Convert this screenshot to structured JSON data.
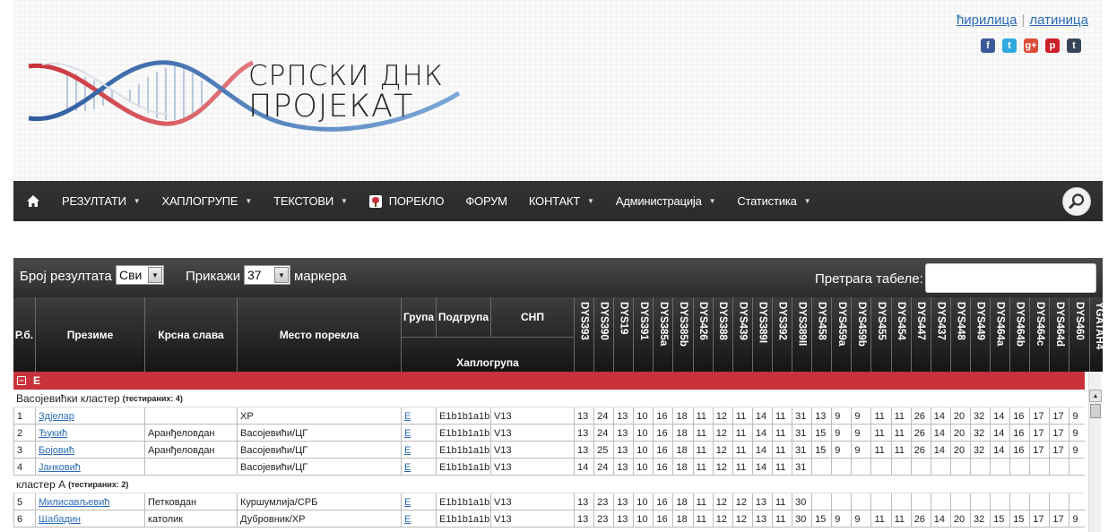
{
  "header": {
    "logo_line1": "СРПСКИ ДНК",
    "logo_line2": "ПРОЈЕКАТ",
    "lang_cyr": "ћирилица",
    "lang_sep": "|",
    "lang_lat": "латиница",
    "social": [
      {
        "name": "facebook-icon",
        "glyph": "f",
        "color": "#3b5998"
      },
      {
        "name": "twitter-icon",
        "glyph": "t",
        "color": "#2fa9e0"
      },
      {
        "name": "google-plus-icon",
        "glyph": "g+",
        "color": "#dd4b39"
      },
      {
        "name": "pinterest-icon",
        "glyph": "p",
        "color": "#cb2027"
      },
      {
        "name": "tumblr-icon",
        "glyph": "t",
        "color": "#35465c"
      }
    ]
  },
  "nav": {
    "items": [
      {
        "label": "РЕЗУЛТАТИ",
        "caret": true
      },
      {
        "label": "ХАПЛОГРУПЕ",
        "caret": true
      },
      {
        "label": "ТЕКСТОВИ",
        "caret": true
      },
      {
        "label": "ПОРЕКЛО",
        "caret": false,
        "icon": true
      },
      {
        "label": "ФОРУМ",
        "caret": false
      },
      {
        "label": "КОНТАКТ",
        "caret": true
      },
      {
        "label": "Администрација",
        "caret": true
      },
      {
        "label": "Статистика",
        "caret": true
      }
    ]
  },
  "toolbar": {
    "results_label": "Број резултата",
    "results_value": "Сви",
    "show_label": "Прикажи",
    "show_value": "37",
    "markers_label": "маркера",
    "search_label": "Претрага табеле:"
  },
  "table": {
    "headers": {
      "rb": "Р.б.",
      "surname": "Презиме",
      "slava": "Крсна слава",
      "place": "Место порекла",
      "group": "Група",
      "subgroup": "Подгрупа",
      "snp": "СНП",
      "haplogroup": "Хаплогрупа"
    },
    "markers": [
      "DYS393",
      "DYS390",
      "DYS19",
      "DYS391",
      "DYS385a",
      "DYS385b",
      "DYS426",
      "DYS388",
      "DYS439",
      "DYS389I",
      "DYS392",
      "DYS389II",
      "DYS458",
      "DYS459a",
      "DYS459b",
      "DYS455",
      "DYS454",
      "DYS447",
      "DYS437",
      "DYS448",
      "DYS449",
      "DYS464a",
      "DYS464b",
      "DYS464c",
      "DYS464d",
      "DYS460",
      "YGATAH4"
    ],
    "group_label": "E",
    "clusters": [
      {
        "title": "Васојевићки кластер",
        "note": "(тестираних: 4)",
        "rows": [
          {
            "n": "1",
            "surname": "Здјелар",
            "slava": "",
            "place": "ХР",
            "group": "E",
            "subgroup": "E1b1b1a1b",
            "snp": "V13",
            "values": [
              "13",
              "24",
              "13",
              "10",
              "16",
              "18",
              "11",
              "12",
              "11",
              "14",
              "11",
              "31",
              "13",
              "9",
              "9",
              "11",
              "11",
              "26",
              "14",
              "20",
              "32",
              "14",
              "16",
              "17",
              "17",
              "9",
              ""
            ]
          },
          {
            "n": "2",
            "surname": "Ђукић",
            "slava": "Аранђеловдан",
            "place": "Васојевићи/ЦГ",
            "group": "E",
            "subgroup": "E1b1b1a1b",
            "snp": "V13",
            "values": [
              "13",
              "24",
              "13",
              "10",
              "16",
              "18",
              "11",
              "12",
              "11",
              "14",
              "11",
              "31",
              "15",
              "9",
              "9",
              "11",
              "11",
              "26",
              "14",
              "20",
              "32",
              "14",
              "16",
              "17",
              "17",
              "9",
              ""
            ]
          },
          {
            "n": "3",
            "surname": "Бојовић",
            "slava": "Аранђеловдан",
            "place": "Васојевићи/ЦГ",
            "group": "E",
            "subgroup": "E1b1b1a1b",
            "snp": "V13",
            "values": [
              "13",
              "25",
              "13",
              "10",
              "16",
              "18",
              "11",
              "12",
              "11",
              "14",
              "11",
              "31",
              "15",
              "9",
              "9",
              "11",
              "11",
              "26",
              "14",
              "20",
              "32",
              "14",
              "16",
              "17",
              "17",
              "9",
              ""
            ]
          },
          {
            "n": "4",
            "surname": "Јанковић",
            "slava": "",
            "place": "Васојевићи/ЦГ",
            "group": "E",
            "subgroup": "E1b1b1a1b",
            "snp": "V13",
            "values": [
              "14",
              "24",
              "13",
              "10",
              "16",
              "18",
              "11",
              "12",
              "11",
              "14",
              "11",
              "31",
              "",
              "",
              "",
              "",
              "",
              "",
              "",
              "",
              "",
              "",
              "",
              "",
              "",
              "",
              ""
            ]
          }
        ]
      },
      {
        "title": "кластер А",
        "note": "(тестираних: 2)",
        "rows": [
          {
            "n": "5",
            "surname": "Милисављевић",
            "slava": "Петковдан",
            "place": "Куршумлија/СРБ",
            "group": "E",
            "subgroup": "E1b1b1a1b",
            "snp": "V13",
            "values": [
              "13",
              "23",
              "13",
              "10",
              "16",
              "18",
              "11",
              "12",
              "12",
              "13",
              "11",
              "30",
              "",
              "",
              "",
              "",
              "",
              "",
              "",
              "",
              "",
              "",
              "",
              "",
              "",
              "",
              ""
            ]
          },
          {
            "n": "6",
            "surname": "Шабадин",
            "slava": "католик",
            "place": "Дубровник/ХР",
            "group": "E",
            "subgroup": "E1b1b1a1b",
            "snp": "V13",
            "values": [
              "13",
              "23",
              "13",
              "10",
              "16",
              "18",
              "11",
              "12",
              "12",
              "13",
              "11",
              "30",
              "15",
              "9",
              "9",
              "11",
              "11",
              "26",
              "14",
              "20",
              "32",
              "15",
              "15",
              "17",
              "17",
              "9",
              ""
            ]
          }
        ]
      }
    ]
  }
}
